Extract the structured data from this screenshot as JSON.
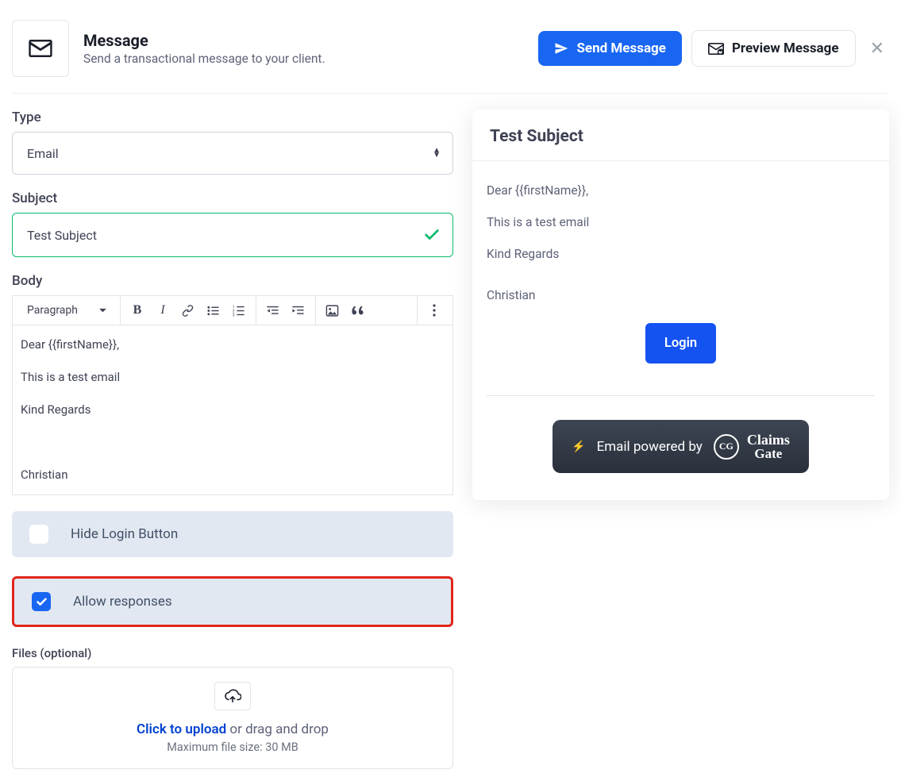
{
  "header": {
    "title": "Message",
    "subtitle": "Send a transactional message to your client.",
    "send_label": "Send Message",
    "preview_label": "Preview Message"
  },
  "form": {
    "type_label": "Type",
    "type_value": "Email",
    "subject_label": "Subject",
    "subject_value": "Test Subject",
    "body_label": "Body",
    "toolbar": {
      "paragraph_label": "Paragraph"
    },
    "body_lines": {
      "l1": "Dear {{firstName}},",
      "l2": "This is a test email",
      "l3": "Kind Regards",
      "l4": "",
      "l5": "Christian"
    },
    "hide_login_label": "Hide Login Button",
    "hide_login_checked": false,
    "allow_responses_label": "Allow responses",
    "allow_responses_checked": true,
    "files_label": "Files (optional)",
    "upload_link": "Click to upload",
    "upload_rest": " or drag and drop",
    "upload_sub": "Maximum file size: 30 MB"
  },
  "preview": {
    "subject": "Test Subject",
    "lines": {
      "l1": "Dear {{firstName}},",
      "l2": "This is a test email",
      "l3": "Kind Regards",
      "l4": "Christian"
    },
    "login_label": "Login",
    "powered_text": "Email powered by",
    "brand_top": "Claims",
    "brand_bottom": "Gate",
    "brand_initials": "CG"
  }
}
